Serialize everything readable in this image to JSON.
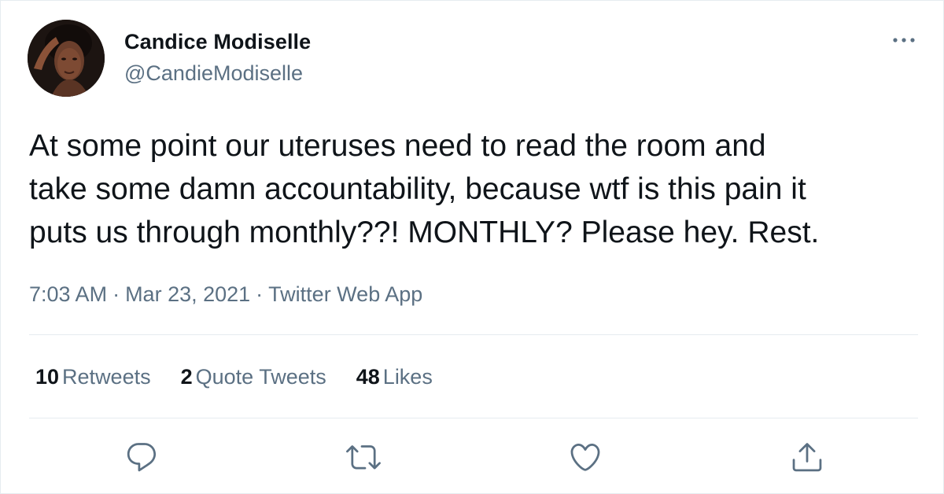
{
  "author": {
    "display_name": "Candice Modiselle",
    "handle": "@CandieModiselle"
  },
  "tweet": {
    "lines": [
      "At some point our uteruses need to read the room and",
      "take some damn accountability, because wtf is this pain it",
      "puts us through monthly??! MONTHLY? Please hey. Rest."
    ],
    "time": "7:03 AM",
    "date": "Mar 23, 2021",
    "source": "Twitter Web App",
    "separator": "·"
  },
  "stats": {
    "retweets_count": "10",
    "retweets_label": "Retweets",
    "quotes_count": "2",
    "quotes_label": "Quote Tweets",
    "likes_count": "48",
    "likes_label": "Likes"
  },
  "icons": {
    "more": "more-horizontal-icon",
    "reply": "reply-icon",
    "retweet": "retweet-icon",
    "like": "heart-icon",
    "share": "share-icon"
  },
  "colors": {
    "text_primary": "#0f1419",
    "text_secondary": "#5b7083",
    "divider": "#e6ecf0",
    "icon": "#5b7083"
  }
}
